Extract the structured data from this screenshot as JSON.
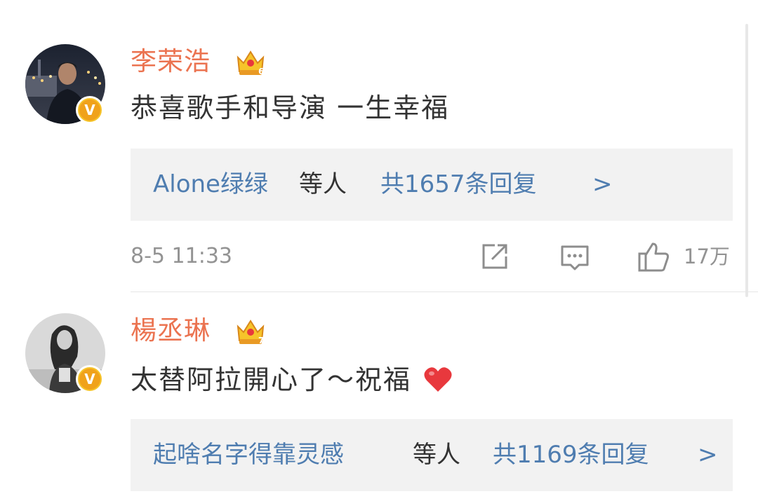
{
  "comments": [
    {
      "username": "李荣浩",
      "crown_level": "6",
      "verified_mark": "V",
      "text": "恭喜歌手和导演 一生幸福",
      "reply_names": "Alone绿绿",
      "reply_suffix": "等人",
      "reply_count_text": "共1657条回复",
      "reply_chevron": ">",
      "timestamp": "8-5 11:33",
      "like_count": "17万"
    },
    {
      "username": "楊丞琳",
      "crown_level": "7",
      "verified_mark": "V",
      "text": "太替阿拉開心了～祝福",
      "reply_names": "起啥名字得靠灵感",
      "reply_suffix": "等人",
      "reply_count_text": "共1169条回复",
      "reply_chevron": ">"
    }
  ],
  "icons": {
    "share": "share-icon",
    "comment": "comment-icon",
    "like": "thumbs-up-icon",
    "heart": "red-heart-emoji"
  },
  "colors": {
    "username": "#eb7350",
    "link": "#4f7db0",
    "text": "#333333",
    "meta": "#939393",
    "reply_bg": "#f2f2f2",
    "heart": "#e8383d",
    "crown": "#f6c42a"
  }
}
